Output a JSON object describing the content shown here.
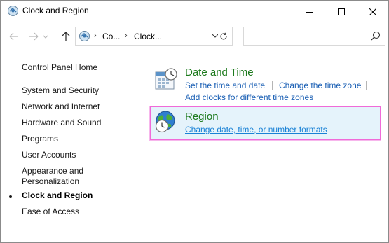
{
  "window": {
    "title": "Clock and Region"
  },
  "address_bar": {
    "crumbs": [
      "Co...",
      "Clock..."
    ],
    "search_placeholder": ""
  },
  "sidebar": {
    "items": [
      {
        "label": "Control Panel Home",
        "active": false
      },
      {
        "label": "System and Security",
        "active": false
      },
      {
        "label": "Network and Internet",
        "active": false
      },
      {
        "label": "Hardware and Sound",
        "active": false
      },
      {
        "label": "Programs",
        "active": false
      },
      {
        "label": "User Accounts",
        "active": false
      },
      {
        "label": "Appearance and",
        "active": false
      },
      {
        "label": "Personalization",
        "active": false
      },
      {
        "label": "Clock and Region",
        "active": true
      },
      {
        "label": "Ease of Access",
        "active": false
      }
    ]
  },
  "categories": {
    "date_time": {
      "title": "Date and Time",
      "links": [
        "Set the time and date",
        "Change the time zone",
        "Add clocks for different time zones"
      ]
    },
    "region": {
      "title": "Region",
      "links": [
        "Change date, time, or number formats"
      ],
      "highlighted": true
    }
  },
  "colors": {
    "category_title": "#1d7a1d",
    "link": "#1a5fb4",
    "highlight_bg": "#e5f3fb",
    "highlight_border": "#f06ad8"
  },
  "icons": {
    "title": "control-panel-icon",
    "date_time": "calendar-clock-icon",
    "region": "globe-clock-icon"
  }
}
